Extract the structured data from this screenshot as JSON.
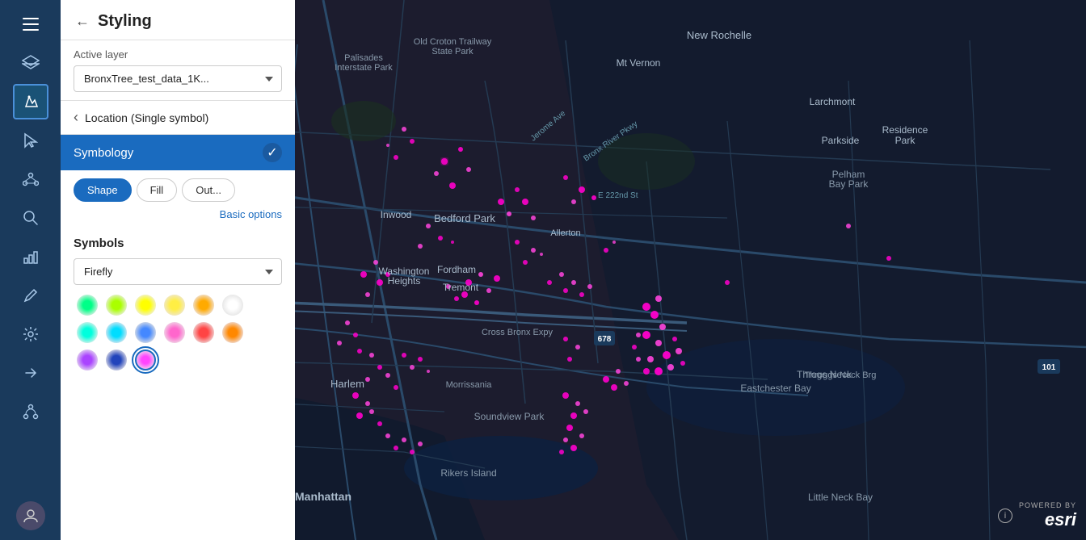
{
  "panel": {
    "title": "Styling",
    "back_label": "←",
    "active_layer_label": "Active layer",
    "layer_name": "BronxTree_test_data_1K...",
    "location_label": "Location (Single symbol)",
    "symbology_label": "Symbology",
    "shape_tab": "Shape",
    "fill_tab": "Fill",
    "out_tab": "Out...",
    "basic_options_link": "Basic options",
    "symbols_label": "Symbols",
    "symbols_dropdown": "Firefly"
  },
  "sidebar": {
    "menu_icon": "☰",
    "layers_icon": "⬡",
    "cursor_icon": "↖",
    "nodes_icon": "⬡",
    "search_icon": "🔍",
    "chart_icon": "📊",
    "pencil_icon": "✏",
    "settings_icon": "⚙",
    "share_icon": "↗",
    "path_icon": "⋯"
  },
  "colors": {
    "accent": "#1a6bbf",
    "sidebar_bg": "#1a3a5c",
    "panel_bg": "#ffffff",
    "map_bg": "#1a1a2e"
  },
  "color_dots": [
    [
      {
        "class": "dot-green",
        "selected": false
      },
      {
        "class": "dot-lime",
        "selected": false
      },
      {
        "class": "dot-yellow",
        "selected": false
      },
      {
        "class": "dot-yellow2",
        "selected": false
      },
      {
        "class": "dot-orange",
        "selected": false
      },
      {
        "class": "dot-white",
        "selected": false
      }
    ],
    [
      {
        "class": "dot-teal",
        "selected": false
      },
      {
        "class": "dot-cyan",
        "selected": false
      },
      {
        "class": "dot-blue",
        "selected": false
      },
      {
        "class": "dot-pink",
        "selected": false
      },
      {
        "class": "dot-magenta",
        "selected": false
      },
      {
        "class": "dot-red",
        "selected": false
      }
    ]
  ],
  "esri": {
    "powered_by": "POWERED BY",
    "logo": "esri"
  }
}
